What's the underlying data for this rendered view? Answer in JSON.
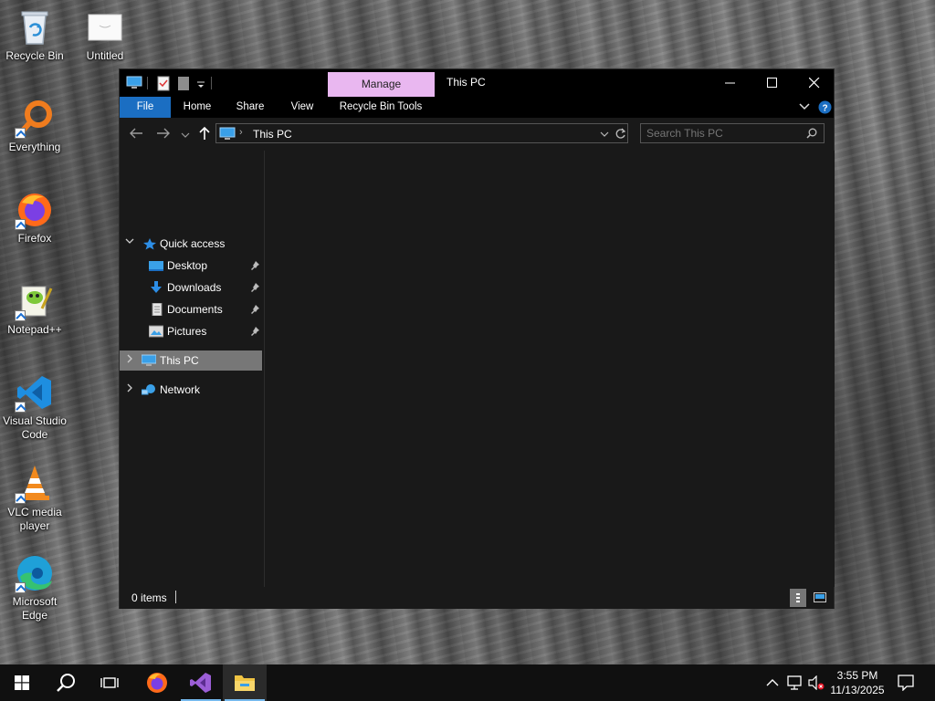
{
  "desktop": {
    "icons": [
      {
        "name": "recycle-bin",
        "label": "Recycle Bin"
      },
      {
        "name": "untitled",
        "label": "Untitled"
      },
      {
        "name": "everything",
        "label": "Everything"
      },
      {
        "name": "firefox",
        "label": "Firefox"
      },
      {
        "name": "notepad-plus-plus",
        "label": "Notepad++"
      },
      {
        "name": "vscode",
        "label_line1": "Visual Studio",
        "label_line2": "Code"
      },
      {
        "name": "vlc",
        "label_line1": "VLC media",
        "label_line2": "player"
      },
      {
        "name": "edge",
        "label_line1": "Microsoft",
        "label_line2": "Edge"
      }
    ]
  },
  "explorer": {
    "title": "This PC",
    "contextual_tab": "Manage",
    "ribbon_tabs": [
      "File",
      "Home",
      "Share",
      "View",
      "Recycle Bin Tools"
    ],
    "address": {
      "path": "This PC"
    },
    "search": {
      "placeholder": "Search This PC"
    },
    "nav": {
      "quick_access": "Quick access",
      "pinned": [
        "Desktop",
        "Downloads",
        "Documents",
        "Pictures"
      ],
      "this_pc": "This PC",
      "network": "Network"
    },
    "status": {
      "items": "0 items"
    }
  },
  "taskbar": {
    "time": "3:55 PM",
    "date": "11/13/2025"
  },
  "colors": {
    "accent": "#1b6ec2",
    "manage_tab": "#e9b7f0",
    "selection": "#777777"
  }
}
